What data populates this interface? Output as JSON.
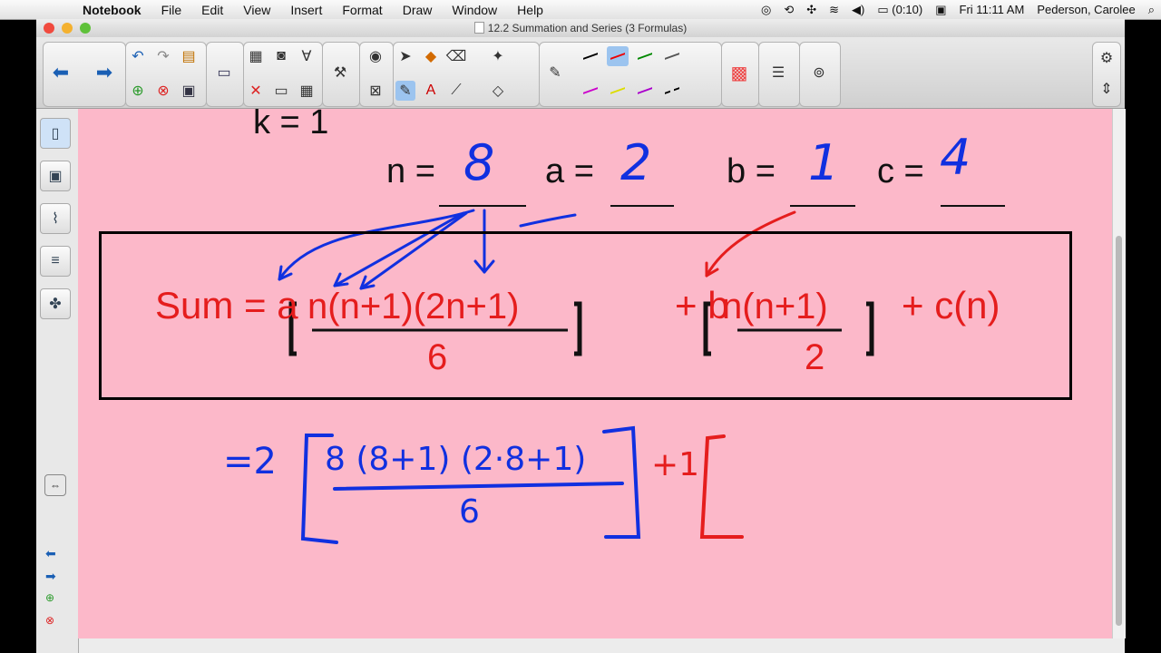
{
  "menubar": {
    "app_name": "Notebook",
    "items": [
      "File",
      "Edit",
      "View",
      "Insert",
      "Format",
      "Draw",
      "Window",
      "Help"
    ],
    "battery": "(0:10)",
    "clock": "Fri 11:11 AM",
    "user": "Pederson, Carolee"
  },
  "window": {
    "title": "12.2 Summation and Series (3 Formulas)"
  },
  "colors": {
    "canvas": "#fcb8c9",
    "red_ink": "#e51d1d",
    "blue_ink": "#1030e0",
    "traffic_close": "#f04a3e",
    "traffic_min": "#f4b12f",
    "traffic_max": "#5fc13a"
  },
  "toolbar": {
    "icons": [
      "back-arrow-icon",
      "forward-arrow-icon",
      "undo-icon",
      "redo-icon",
      "paste-icon",
      "add-page-icon",
      "delete-page-icon",
      "save-icon",
      "screen-shade-icon",
      "document-camera-icon",
      "capture-icon",
      "table-icon",
      "select-icon",
      "pens-icon",
      "eraser-icon",
      "text-icon",
      "line-icon",
      "shapes-icon",
      "magic-pen-icon",
      "fill-icon",
      "properties-icon",
      "settings-icon"
    ]
  },
  "sidebar": {
    "tabs": [
      "page-sorter-icon",
      "gallery-icon",
      "attachments-icon",
      "properties-icon",
      "addons-icon"
    ]
  },
  "page": {
    "k_line": "k = 1",
    "n_label": "n =",
    "a_label": "a =",
    "b_label": "b =",
    "c_label": "c =",
    "n_value": "8",
    "a_value": "2",
    "b_value": "1",
    "c_value": "4",
    "formula": {
      "sum_prefix": "Sum = a",
      "frac1_num": "n(n+1)(2n+1)",
      "frac1_den": "6",
      "plus_b": "+ b",
      "frac2_num": "n(n+1)",
      "frac2_den": "2",
      "plus_cn": "+ c(n)"
    },
    "work": {
      "eq2": "=2",
      "num": "8 (8+1) (2·8+1)",
      "den": "6",
      "plus1": "+1"
    }
  }
}
